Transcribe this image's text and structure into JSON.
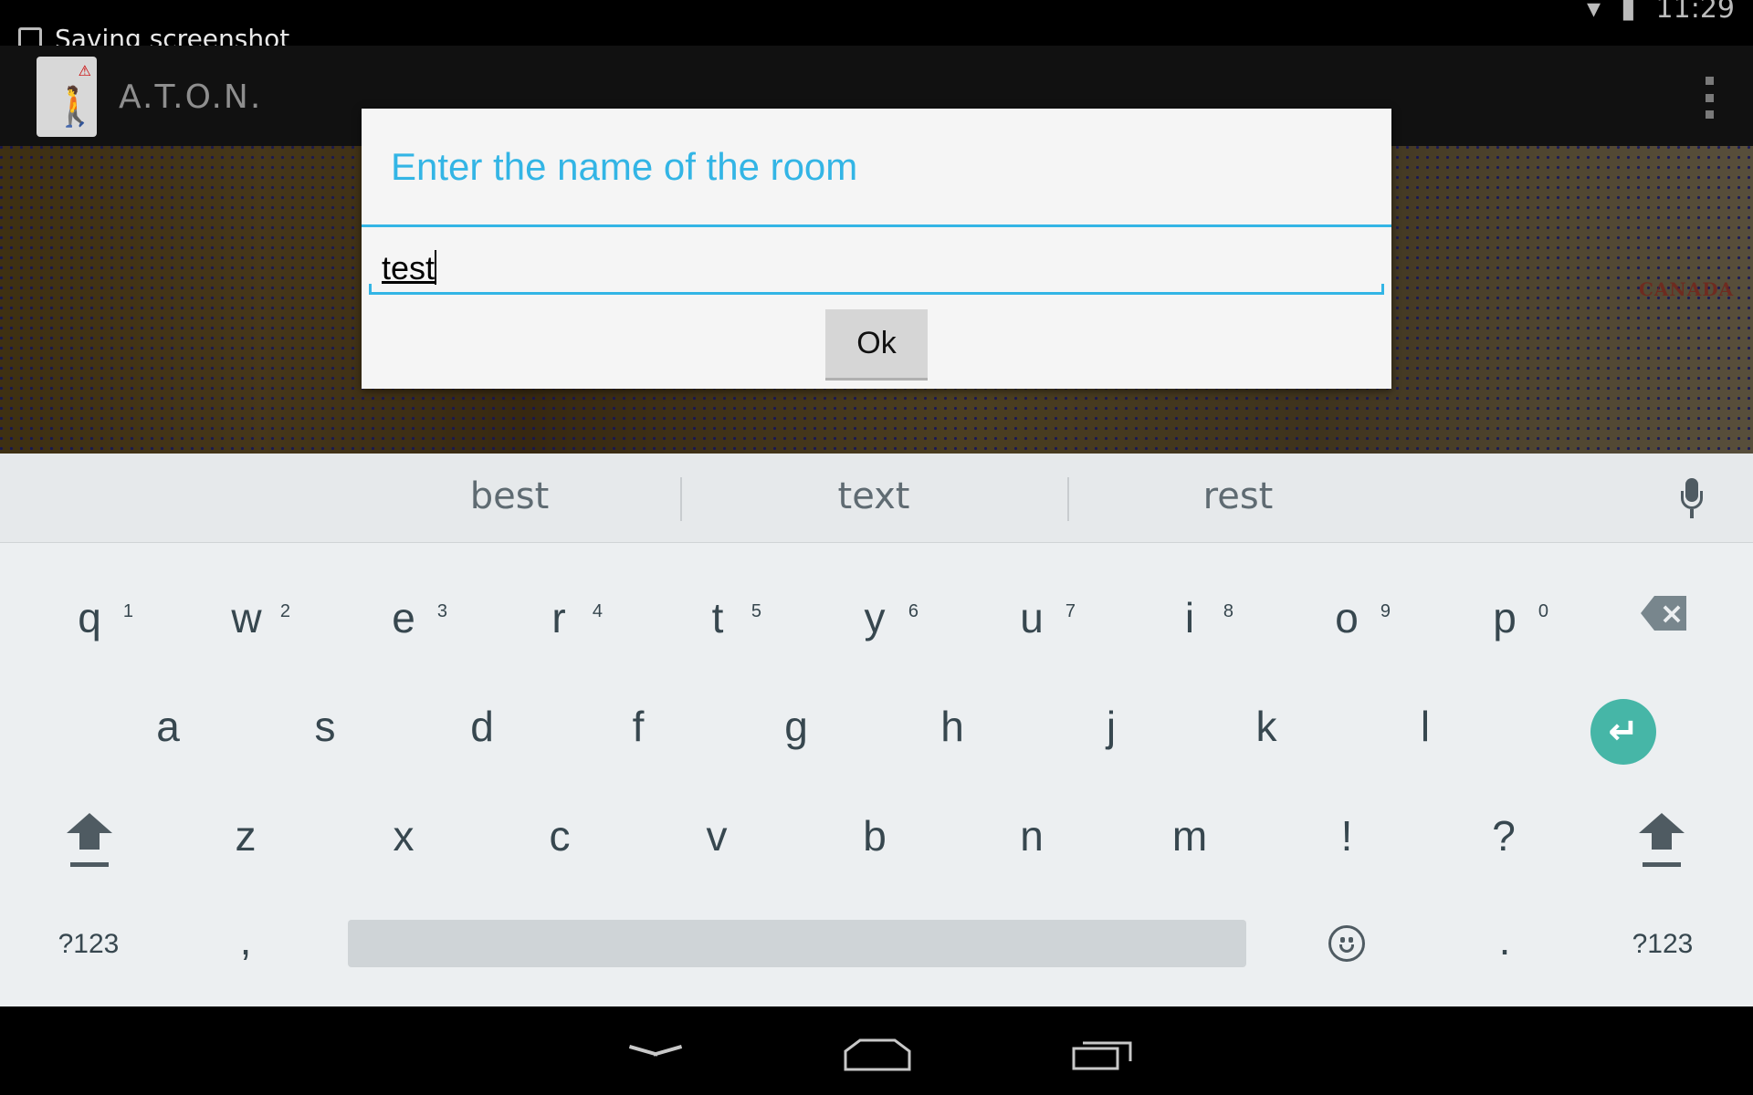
{
  "status_bar": {
    "notification": "Saving screenshot",
    "clock": "11:29"
  },
  "action_bar": {
    "app_title": "A.T.O.N."
  },
  "background": {
    "map_label": "CANADA"
  },
  "dialog": {
    "title": "Enter the name of the room",
    "input_value": "test",
    "ok_label": "Ok"
  },
  "keyboard": {
    "suggestions": [
      "best",
      "text",
      "rest"
    ],
    "row1": [
      {
        "key": "q",
        "hint": "1"
      },
      {
        "key": "w",
        "hint": "2"
      },
      {
        "key": "e",
        "hint": "3"
      },
      {
        "key": "r",
        "hint": "4"
      },
      {
        "key": "t",
        "hint": "5"
      },
      {
        "key": "y",
        "hint": "6"
      },
      {
        "key": "u",
        "hint": "7"
      },
      {
        "key": "i",
        "hint": "8"
      },
      {
        "key": "o",
        "hint": "9"
      },
      {
        "key": "p",
        "hint": "0"
      }
    ],
    "row2": [
      "a",
      "s",
      "d",
      "f",
      "g",
      "h",
      "j",
      "k",
      "l"
    ],
    "row3": [
      "z",
      "x",
      "c",
      "v",
      "b",
      "n",
      "m",
      "!",
      "?"
    ],
    "symbols_left": "?123",
    "comma": ",",
    "period": ".",
    "symbols_right": "?123"
  },
  "icons": {
    "backspace": "backspace-icon",
    "enter": "enter-icon",
    "shift": "shift-icon",
    "mic": "microphone-icon",
    "emoji": "emoji-icon",
    "nav_back": "nav-back-icon",
    "nav_home": "nav-home-icon",
    "nav_recent": "nav-recent-apps-icon"
  },
  "colors": {
    "accent": "#33b5e5",
    "enter_key": "#46b6a7",
    "keyboard_bg": "#eceff1"
  }
}
